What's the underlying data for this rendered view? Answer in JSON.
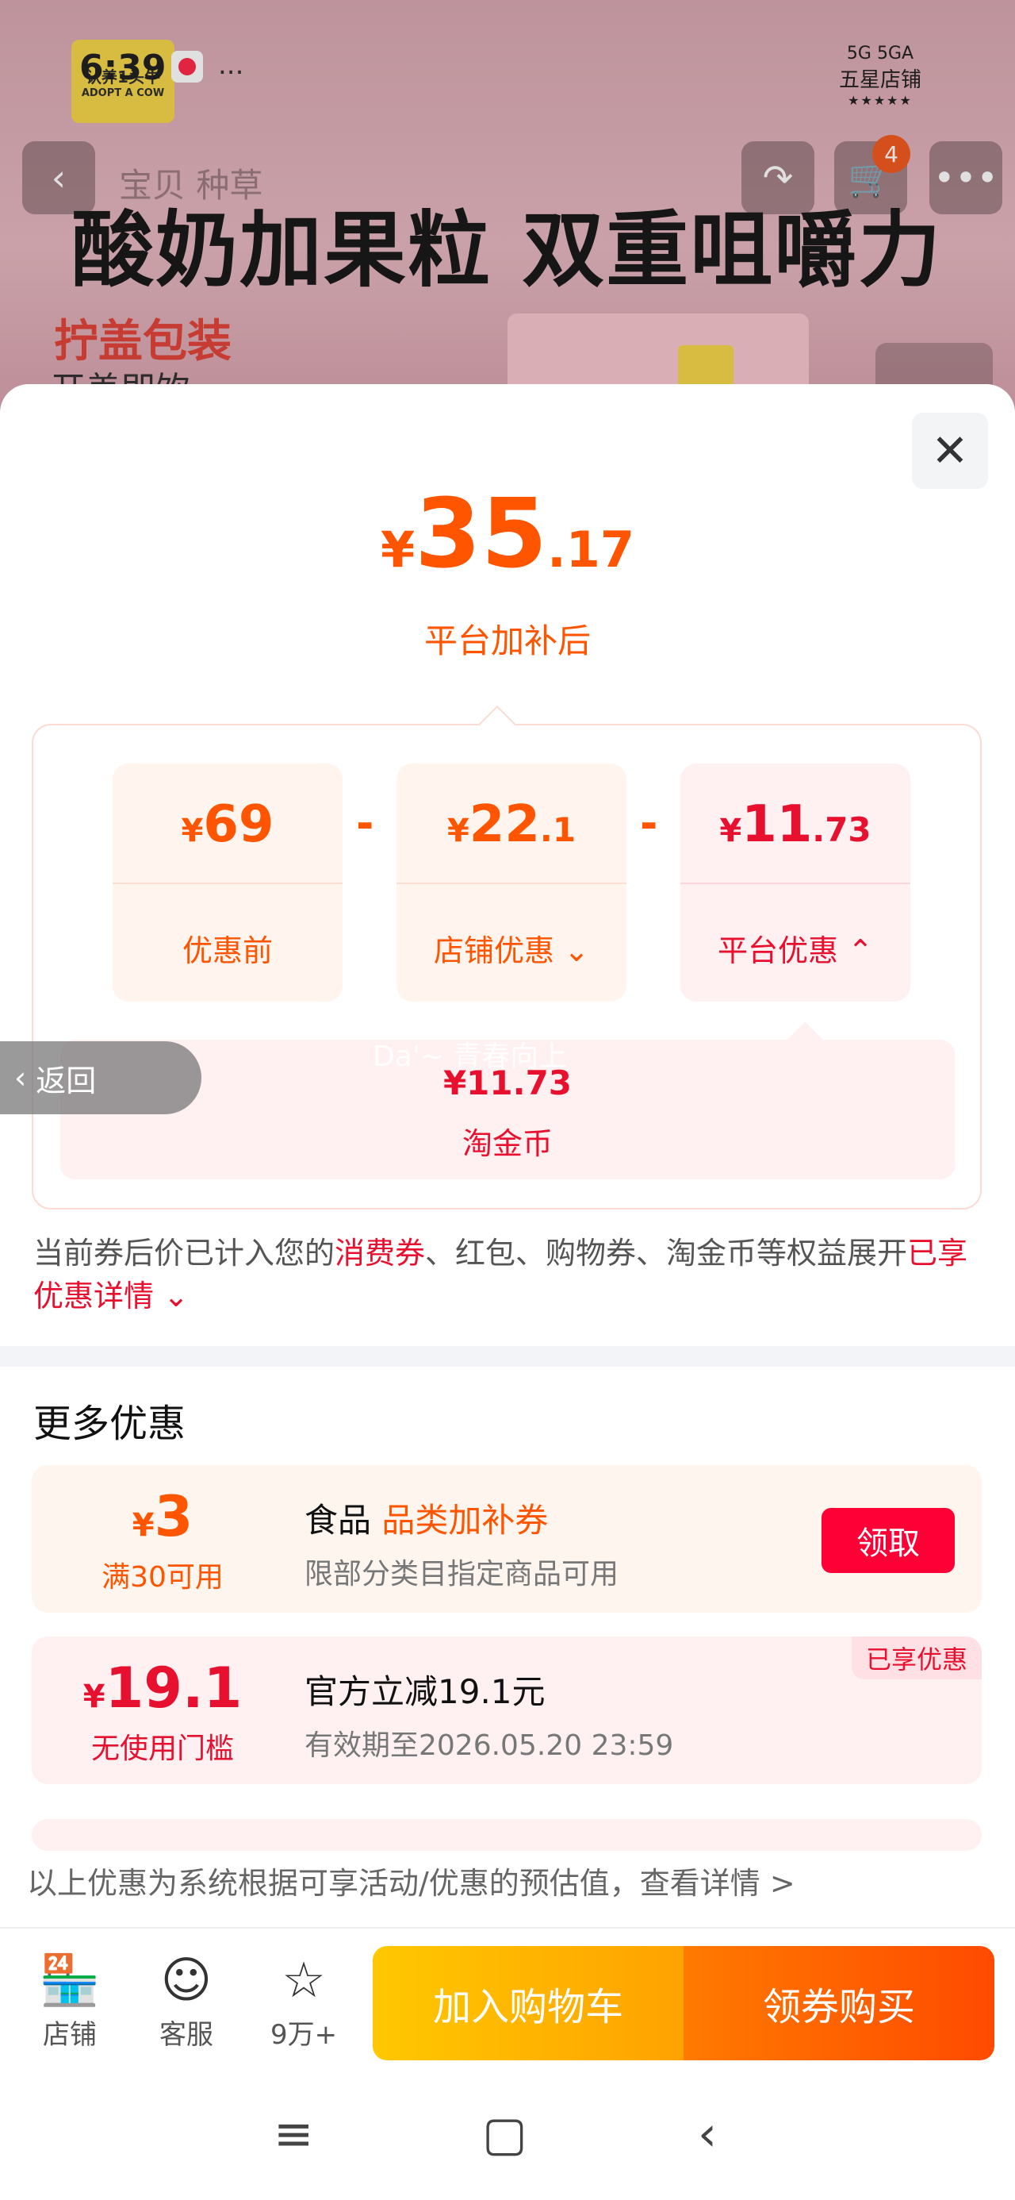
{
  "status": {
    "time": "6:39",
    "network": "5G 5GA",
    "dots": "..."
  },
  "brand": {
    "logo_text": "认养1头牛",
    "logo_sub": "ADOPT A COW",
    "seal_title": "五星店铺",
    "seal_stars": "★★★★★"
  },
  "header": {
    "tabs_hint": "宝贝  种草",
    "cart_count": "4"
  },
  "banner": {
    "title": "酸奶加果粒 双重咀嚼力",
    "subtitle": "拧盖包装",
    "subtitle2": "开盖即饮"
  },
  "sheet": {
    "price": {
      "yen": "¥",
      "integer": "35",
      "decimal": ".17",
      "caption": "平台加补后"
    },
    "breakdown": [
      {
        "yen": "¥",
        "integer": "69",
        "decimal": "",
        "label": "优惠前"
      },
      {
        "yen": "¥",
        "integer": "22",
        "decimal": ".1",
        "label": "店铺优惠"
      },
      {
        "yen": "¥",
        "integer": "11",
        "decimal": ".73",
        "label": "平台优惠"
      }
    ],
    "minus": "-",
    "sub_item": {
      "value": "¥11.73",
      "label": "淘金币"
    },
    "watermark": "Da'~ 青春向上",
    "note": {
      "p1": "当前券后价已计入您的",
      "hl1": "消费券",
      "p2": "、红包、购物券、淘金币等权益展开",
      "hl2": "已享优惠详情"
    },
    "more_title": "更多优惠",
    "float_back": "返回",
    "offers": [
      {
        "yen": "¥",
        "amount": "3",
        "condition": "满30可用",
        "title_prefix": "食品 ",
        "title_hl": "品类加补券",
        "desc": "限部分类目指定商品可用",
        "button": "领取"
      },
      {
        "yen": "¥",
        "amount": "19.1",
        "condition": "无使用门槛",
        "title": "官方立减19.1元",
        "desc": "有效期至2026.05.20 23:59",
        "tag": "已享优惠"
      }
    ],
    "footnote": "以上优惠为系统根据可享活动/优惠的预估值，查看详情 >"
  },
  "bottom": {
    "shop": "店铺",
    "service": "客服",
    "favorites": "9万+",
    "add_cart": "加入购物车",
    "buy": "领券购买"
  },
  "colors": {
    "accent": "#ff5500",
    "red": "#e8102f",
    "button_red": "#ff0036"
  }
}
